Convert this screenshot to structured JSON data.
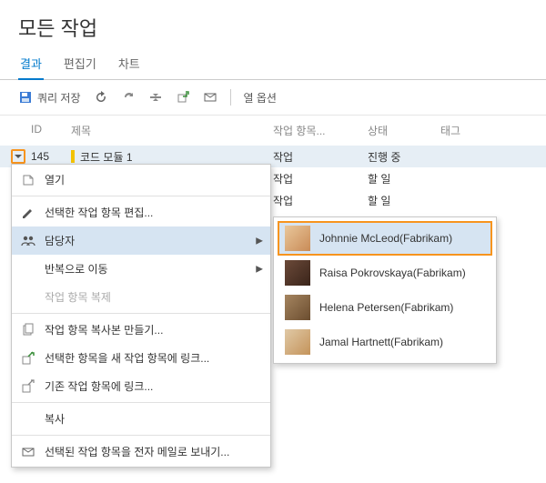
{
  "page": {
    "title": "모든 작업"
  },
  "tabs": {
    "results": "결과",
    "editor": "편집기",
    "chart": "차트"
  },
  "toolbar": {
    "save_query": "쿼리 저장",
    "column_options": "열 옵션"
  },
  "columns": {
    "id": "ID",
    "title": "제목",
    "work_item": "작업 항목...",
    "state": "상태",
    "tags": "태그"
  },
  "rows": [
    {
      "id": "145",
      "title": "코드 모듈 1",
      "type": "작업",
      "state": "진행 중"
    },
    {
      "id": "",
      "title": "",
      "type": "작업",
      "state": "할 일"
    },
    {
      "id": "",
      "title": "",
      "type": "작업",
      "state": "할 일"
    }
  ],
  "context_menu": {
    "open": "열기",
    "edit_selected": "선택한 작업 항목 편집...",
    "assigned_to": "담당자",
    "move_to_iteration": "반복으로 이동",
    "duplicate_disabled": "작업 항목 복제",
    "create_copy": "작업 항목 복사본 만들기...",
    "link_new": "선택한 항목을 새 작업 항목에 링크...",
    "link_existing": "기존 작업 항목에 링크...",
    "copy": "복사",
    "email_selected": "선택된 작업 항목을 전자 메일로 보내기..."
  },
  "assignees": [
    {
      "name": "Johnnie McLeod(Fabrikam)"
    },
    {
      "name": "Raisa Pokrovskaya(Fabrikam)"
    },
    {
      "name": "Helena Petersen(Fabrikam)"
    },
    {
      "name": "Jamal Hartnett(Fabrikam)"
    }
  ]
}
